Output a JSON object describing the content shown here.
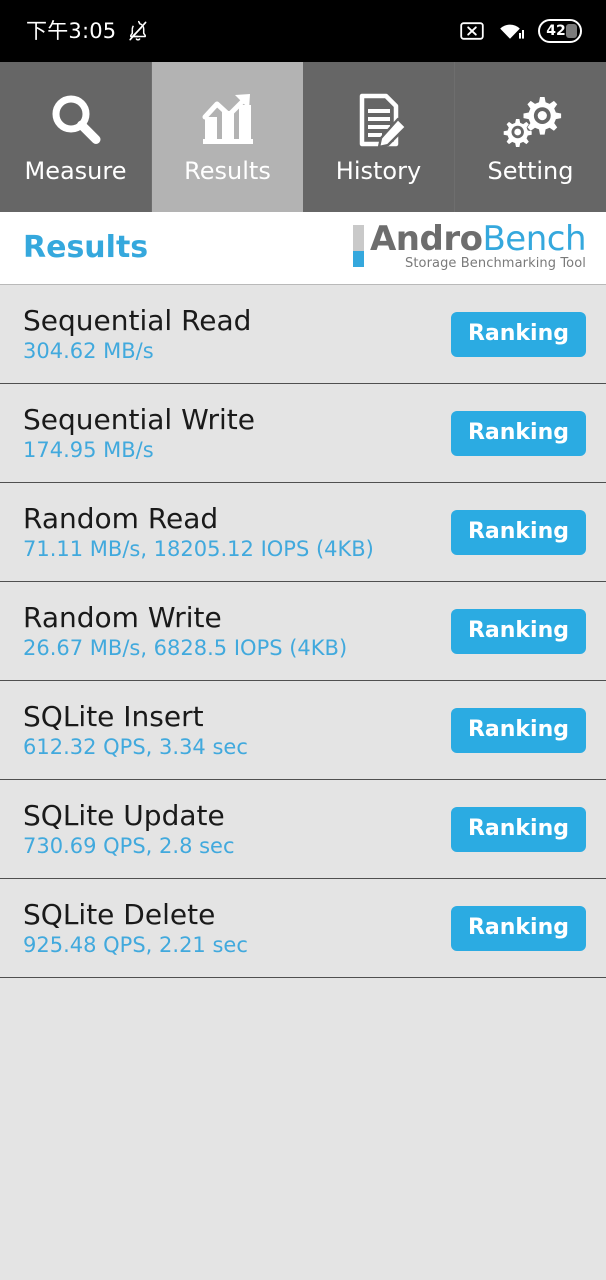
{
  "status_bar": {
    "time": "下午3:05",
    "silent_icon": "bell-off-icon",
    "no_sim_icon": "no-sim-icon",
    "wifi_icon": "wifi-icon",
    "battery_icon": "battery-icon",
    "battery_level": "42",
    "battery_percent": 42,
    "background_color": "#000000",
    "foreground_color": "#ffffff"
  },
  "tabs": [
    {
      "label": "Measure",
      "icon": "magnifier-icon",
      "selected": false
    },
    {
      "label": "Results",
      "icon": "bar-chart-arrow-icon",
      "selected": true
    },
    {
      "label": "History",
      "icon": "document-pencil-icon",
      "selected": false
    },
    {
      "label": "Setting",
      "icon": "gears-icon",
      "selected": false
    }
  ],
  "header": {
    "title": "Results",
    "title_color": "#35a8dd",
    "logo": {
      "name_part1": "Andro",
      "name_part2": "Bench",
      "tagline": "Storage Benchmarking Tool",
      "part1_color": "#6d6d6d",
      "part2_color": "#35a8dd"
    }
  },
  "results": [
    {
      "title": "Sequential Read",
      "value": "304.62 MB/s",
      "button": "Ranking"
    },
    {
      "title": "Sequential Write",
      "value": "174.95 MB/s",
      "button": "Ranking"
    },
    {
      "title": "Random Read",
      "value": "71.11 MB/s, 18205.12 IOPS (4KB)",
      "button": "Ranking"
    },
    {
      "title": "Random Write",
      "value": "26.67 MB/s, 6828.5 IOPS (4KB)",
      "button": "Ranking"
    },
    {
      "title": "SQLite Insert",
      "value": "612.32 QPS, 3.34 sec",
      "button": "Ranking"
    },
    {
      "title": "SQLite Update",
      "value": "730.69 QPS, 2.8 sec",
      "button": "Ranking"
    },
    {
      "title": "SQLite Delete",
      "value": "925.48 QPS, 2.21 sec",
      "button": "Ranking"
    }
  ],
  "colors": {
    "accent_blue": "#2babe2",
    "value_blue": "#41a9dd",
    "tab_unselected": "#666666",
    "tab_selected": "#b3b3b3",
    "list_background": "#e4e4e4"
  }
}
